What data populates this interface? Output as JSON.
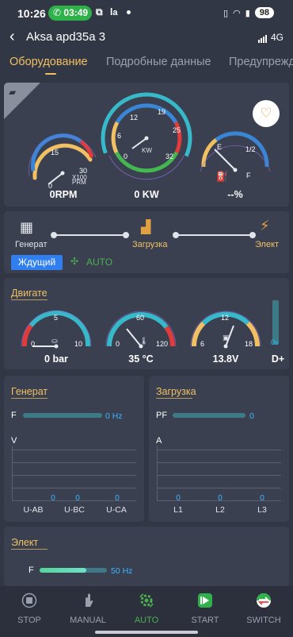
{
  "status_bar": {
    "time": "10:26",
    "call_time": "03:49",
    "battery": "98"
  },
  "header": {
    "title": "Aksa apd35a 3",
    "network": "4G"
  },
  "tabs": [
    "Оборудование",
    "Подробные данные",
    "Предупреждения"
  ],
  "colors": {
    "accent": "#f0c063",
    "active_blue": "#2f7ff0",
    "value_blue": "#38b6ff",
    "green": "#4caf50",
    "card_bg": "#3b4050",
    "page_bg": "#323746"
  },
  "overview": {
    "rpm": {
      "ticks": [
        "0",
        "15",
        "30"
      ],
      "unit": "PRM",
      "unit2": "X100",
      "value": "0RPM",
      "level": 0
    },
    "power": {
      "ticks": [
        "0",
        "6",
        "12",
        "19",
        "25",
        "32"
      ],
      "unit": "KW",
      "value": "0 KW",
      "level": 0
    },
    "fuel": {
      "ticks": [
        "E",
        "1/2",
        "F"
      ],
      "value": "--%",
      "level": 0.45
    }
  },
  "flow": {
    "generator": "Генерат",
    "load": "Загрузка",
    "grid": "Элект",
    "status": "Ждущий",
    "mode": "AUTO"
  },
  "engine": {
    "title": "Двигате",
    "oil": {
      "ticks": [
        "0",
        "5",
        "10"
      ],
      "value": "0 bar",
      "level": 0
    },
    "temp": {
      "ticks": [
        "0",
        "60",
        "120"
      ],
      "value": "35 °C",
      "level": 0.29
    },
    "battery": {
      "ticks": [
        "6",
        "12",
        "18"
      ],
      "value": "13.8V",
      "level": 0.65
    },
    "dplus": {
      "value": "0v",
      "label": "D+"
    }
  },
  "generator_panel": {
    "title": "Генерат",
    "freq_label": "F",
    "freq_value": "0 Hz",
    "axis_label": "V",
    "columns": [
      {
        "label": "U-AB",
        "value": "0"
      },
      {
        "label": "U-BC",
        "value": "0"
      },
      {
        "label": "U-CA",
        "value": "0"
      }
    ]
  },
  "load_panel": {
    "title": "Загрузка",
    "pf_label": "PF",
    "pf_value": "0",
    "axis_label": "A",
    "columns": [
      {
        "label": "L1",
        "value": "0"
      },
      {
        "label": "L2",
        "value": "0"
      },
      {
        "label": "L3",
        "value": "0"
      }
    ]
  },
  "grid_panel": {
    "title": "Элект",
    "freq_label": "F",
    "freq_value": "50 Hz",
    "freq_level": 0.7
  },
  "nav": [
    {
      "label": "STOP",
      "icon": "stop-icon"
    },
    {
      "label": "MANUAL",
      "icon": "hand-icon"
    },
    {
      "label": "AUTO",
      "icon": "auto-icon"
    },
    {
      "label": "START",
      "icon": "start-icon"
    },
    {
      "label": "SWITCH",
      "icon": "switch-icon"
    }
  ]
}
